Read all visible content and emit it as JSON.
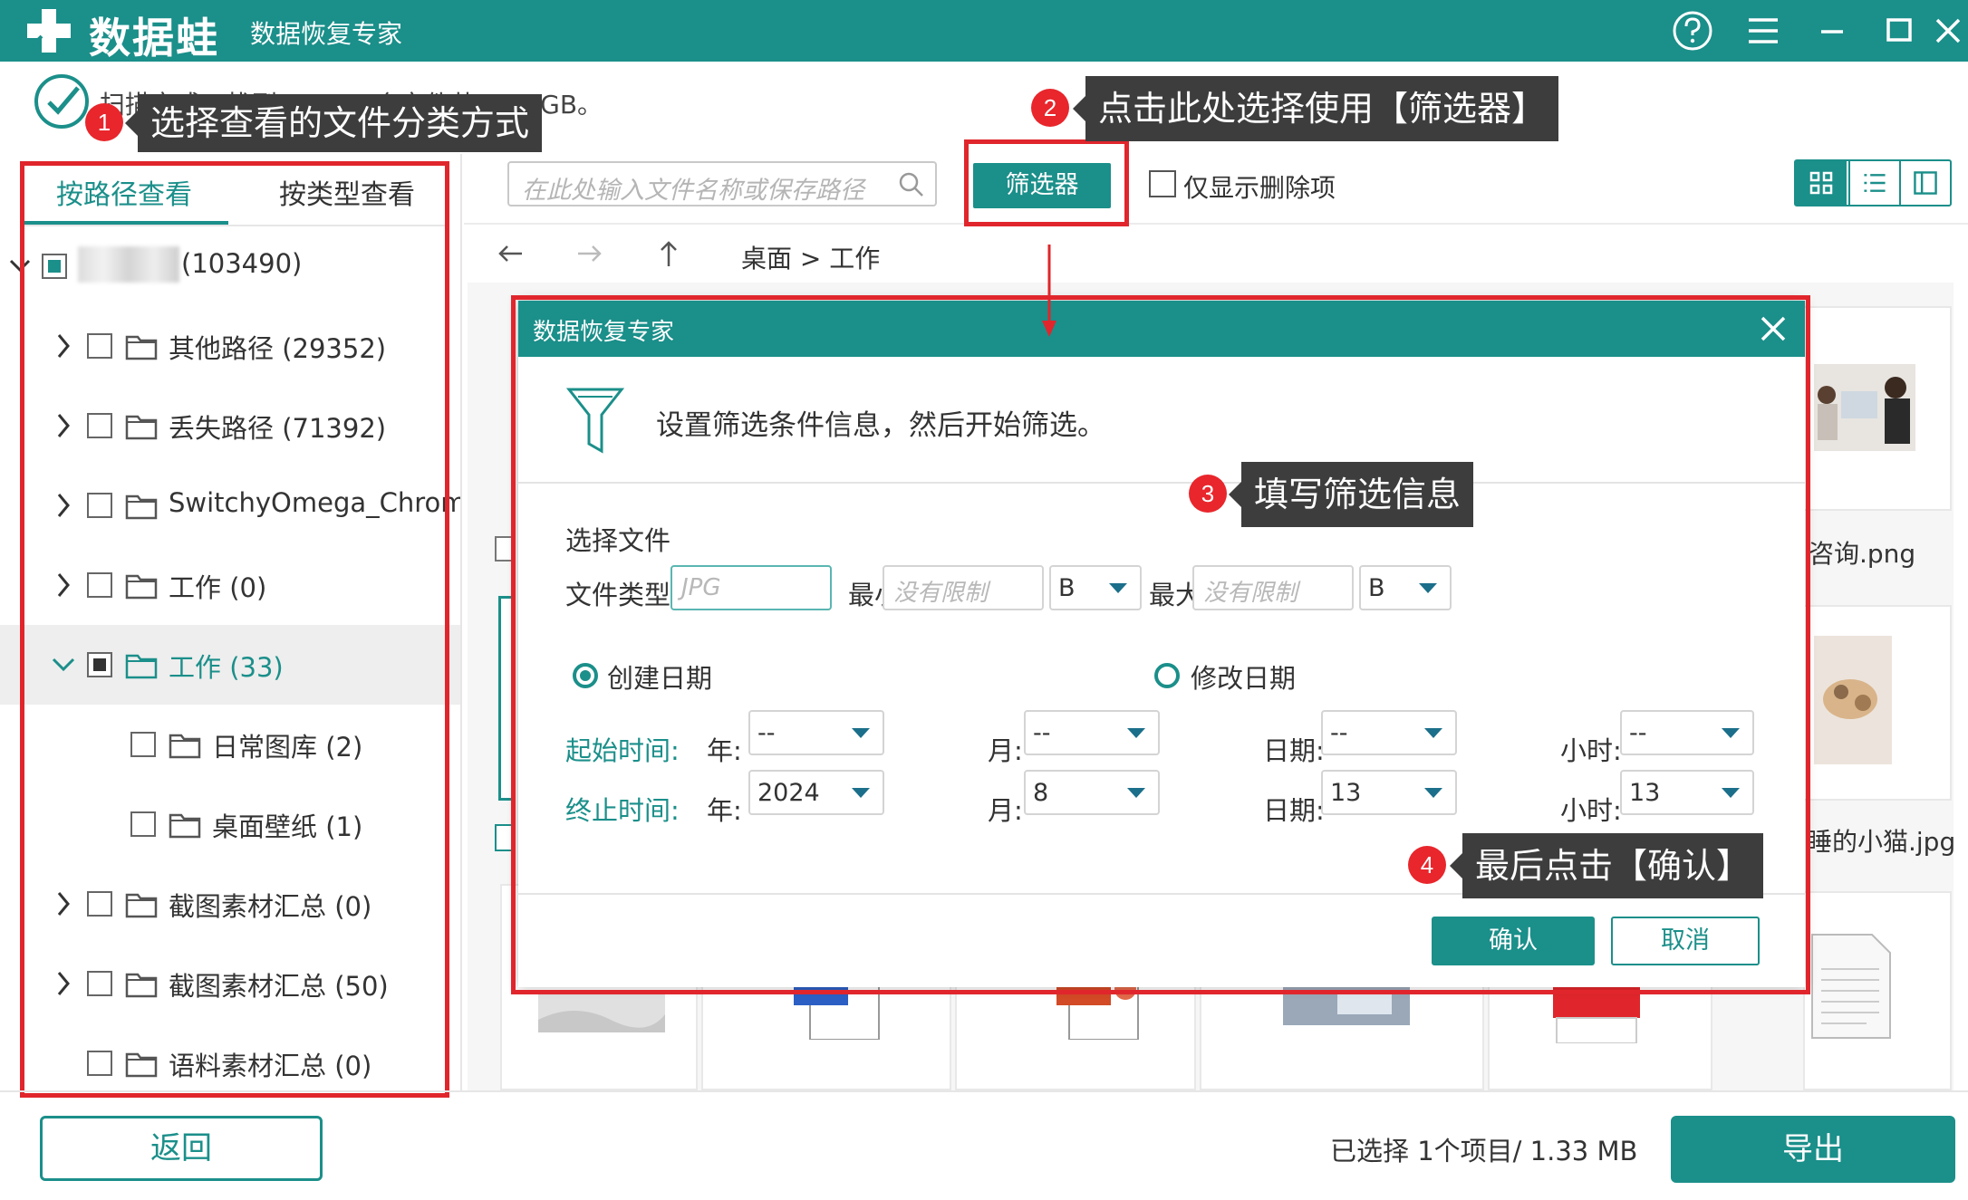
{
  "titlebar": {
    "app_name": "数据蛙",
    "app_subtitle": "数据恢复专家"
  },
  "scan": {
    "status": "扫描完成，找到103490个文件共13.2 GB。"
  },
  "callouts": {
    "c1": {
      "num": "1",
      "text": "选择查看的文件分类方式"
    },
    "c2": {
      "num": "2",
      "text": "点击此处选择使用【筛选器】"
    },
    "c3": {
      "num": "3",
      "text": "填写筛选信息"
    },
    "c4": {
      "num": "4",
      "text": "最后点击【确认】"
    }
  },
  "left_tabs": {
    "by_path": "按路径查看",
    "by_type": "按类型查看"
  },
  "tree": {
    "root_count": "(103490)",
    "items": [
      {
        "label": "其他路径 (29352)"
      },
      {
        "label": "丢失路径 (71392)"
      },
      {
        "label": "SwitchyOmega_Chromium"
      },
      {
        "label": "工作 (0)"
      },
      {
        "label": "工作 (33)"
      },
      {
        "label": "日常图库 (2)"
      },
      {
        "label": "桌面壁纸 (1)"
      },
      {
        "label": "截图素材汇总 (0)"
      },
      {
        "label": "截图素材汇总 (50)"
      },
      {
        "label": "语料素材汇总 (0)"
      }
    ]
  },
  "toolbar": {
    "search_placeholder": "在此处输入文件名称或保存路径",
    "filter_button": "筛选器",
    "only_deleted": "仅显示删除项"
  },
  "breadcrumb": "桌面 > 工作",
  "files": {
    "name_1": "咨询.png",
    "name_2": "睡的小猫.jpg"
  },
  "dialog": {
    "title": "数据恢复专家",
    "intro": "设置筛选条件信息，然后开始筛选。",
    "section": "选择文件",
    "file_type_label": "文件类型:",
    "file_type_placeholder": "JPG",
    "min_label": "最小:",
    "min_placeholder": "没有限制",
    "min_unit": "B",
    "max_label": "最大:",
    "max_placeholder": "没有限制",
    "max_unit": "B",
    "radio_created": "创建日期",
    "radio_modified": "修改日期",
    "start_label": "起始时间:",
    "end_label": "终止时间:",
    "year_label": "年:",
    "month_label": "月:",
    "day_label": "日期:",
    "hour_label": "小时:",
    "start": {
      "year": "--",
      "month": "--",
      "day": "--",
      "hour": "--"
    },
    "end": {
      "year": "2024",
      "month": "8",
      "day": "13",
      "hour": "13"
    },
    "ok": "确认",
    "cancel": "取消"
  },
  "footer": {
    "back": "返回",
    "selection_info": "已选择 1个项目/ 1.33 MB",
    "export": "导出"
  },
  "colors": {
    "brand": "#1b8f8a",
    "highlight_red": "#e0262c",
    "callout_bg": "#3d3d3d"
  }
}
